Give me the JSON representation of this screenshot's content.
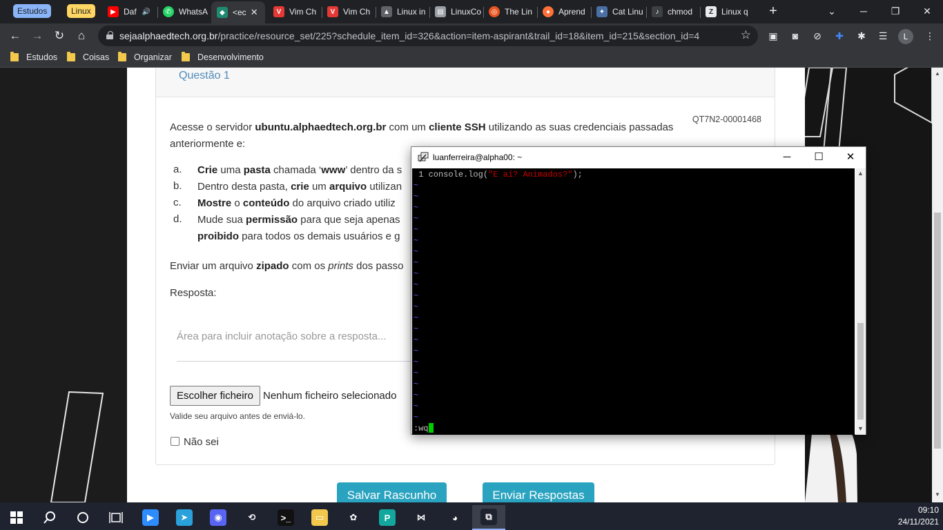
{
  "browser": {
    "tab_groups": [
      {
        "label": "Estudos",
        "bg": "#8ab4f8",
        "fg": "#202124"
      },
      {
        "label": "Linux",
        "bg": "#fdd663",
        "fg": "#202124"
      }
    ],
    "tabs": [
      {
        "title": "Daf",
        "icon": "youtube-icon",
        "color": "#ff0000",
        "glyph": "▶",
        "extra": "🔊"
      },
      {
        "title": "WhatsA",
        "icon": "whatsapp-icon",
        "color": "#25d366",
        "glyph": "✆"
      },
      {
        "title": "<ec",
        "icon": "alphaedtech-icon",
        "color": "#1f8a70",
        "glyph": "◆",
        "active": true
      },
      {
        "title": "Vim Ch",
        "icon": "vim-cheatsheet-icon",
        "color": "#e53935",
        "glyph": "V"
      },
      {
        "title": "Vim Ch",
        "icon": "vim-cheatsheet-icon",
        "color": "#e53935",
        "glyph": "V"
      },
      {
        "title": "Linux in",
        "icon": "linux-icon",
        "color": "#5f6368",
        "glyph": "▲"
      },
      {
        "title": "LinuxCo",
        "icon": "document-icon",
        "color": "#9aa0a6",
        "glyph": "▤"
      },
      {
        "title": "The Lin",
        "icon": "ubuntu-icon",
        "color": "#e95420",
        "glyph": "◎"
      },
      {
        "title": "Aprend",
        "icon": "firefox-icon",
        "color": "#ff7139",
        "glyph": "●"
      },
      {
        "title": "Cat Linu",
        "icon": "cat-icon",
        "color": "#4a6fa5",
        "glyph": "✦"
      },
      {
        "title": "chmod",
        "icon": "chmod-icon",
        "color": "#3c4043",
        "glyph": "♪"
      },
      {
        "title": "Linux q",
        "icon": "z-site-icon",
        "color": "#e8eaed",
        "glyph": "Z"
      }
    ],
    "url_host": "sejaalphaedtech.org.br",
    "url_path": "/practice/resource_set/225?schedule_item_id=326&action=item-aspirant&trail_id=18&item_id=215&section_id=4",
    "profile_initial": "L",
    "bookmarks": [
      "Estudos",
      "Coisas",
      "Organizar",
      "Desenvolvimento"
    ]
  },
  "question": {
    "title": "Questão 1",
    "code": "QT7N2-00001468",
    "intro": {
      "p1": "Acesse o servidor ",
      "b1": "ubuntu.alphaedtech.org.br",
      "p2": " com um ",
      "b2": "cliente SSH",
      "p3": " utilizando as suas credenciais passadas",
      "line2": "anteriormente e:"
    },
    "items": [
      {
        "letter": "a.",
        "parts": [
          {
            "b": "Crie"
          },
          {
            "t": " uma "
          },
          {
            "b": "pasta"
          },
          {
            "t": " chamada ‘"
          },
          {
            "b": "www"
          },
          {
            "t": "’ dentro da s"
          }
        ]
      },
      {
        "letter": "b.",
        "parts": [
          {
            "t": "Dentro desta pasta, "
          },
          {
            "b": "crie"
          },
          {
            "t": " um "
          },
          {
            "b": "arquivo"
          },
          {
            "t": " utilizan"
          }
        ]
      },
      {
        "letter": "c.",
        "parts": [
          {
            "b": "Mostre"
          },
          {
            "t": " o "
          },
          {
            "b": "conteúdo"
          },
          {
            "t": " do arquivo criado utiliz"
          }
        ]
      },
      {
        "letter": "d.",
        "parts": [
          {
            "t": "Mude sua "
          },
          {
            "b": "permissão"
          },
          {
            "t": " para que seja apenas "
          }
        ]
      },
      {
        "letter": "",
        "parts": [
          {
            "b": "proibido"
          },
          {
            "t": " para todos os demais usuários e g"
          }
        ]
      }
    ],
    "send": {
      "p1": "Enviar um arquivo ",
      "b1": "zipado",
      "p2": " com os ",
      "i1": "prints",
      "p3": " dos passo"
    },
    "answer_label": "Resposta:",
    "answer_placeholder": "Área para incluir anotação sobre a resposta...",
    "file_button": "Escolher ficheiro",
    "file_status": "Nenhum ficheiro selecionado",
    "validate_hint": "Valide seu arquivo antes de enviá-lo.",
    "dont_know": "Não sei",
    "save_draft": "Salvar Rascunho",
    "submit": "Enviar Respostas"
  },
  "putty": {
    "title": "luanferreira@alpha00: ~",
    "line1_num": "1",
    "line1_code": "console.log(",
    "line1_str": "\"E aí? Animados?\"",
    "line1_end": ");",
    "tilde_count": 22,
    "command": ":wq"
  },
  "taskbar": {
    "apps": [
      {
        "name": "zoom-icon",
        "color": "#2d8cff",
        "glyph": "▶"
      },
      {
        "name": "telegram-icon",
        "color": "#2aa1da",
        "glyph": "➤"
      },
      {
        "name": "discord-icon",
        "color": "#5865f2",
        "glyph": "◉"
      },
      {
        "name": "network-icon",
        "color": "#1f2330",
        "glyph": "⟲"
      },
      {
        "name": "terminal-icon",
        "color": "#111111",
        "glyph": ">_"
      },
      {
        "name": "file-explorer-icon",
        "color": "#f2c94c",
        "glyph": "▭"
      },
      {
        "name": "figma-icon",
        "color": "#1f2330",
        "glyph": "✿"
      },
      {
        "name": "postman-icon",
        "color": "#13a89e",
        "glyph": "P"
      },
      {
        "name": "vscode-icon",
        "color": "#1f2330",
        "glyph": "⋈"
      },
      {
        "name": "chrome-icon",
        "color": "#1f2330",
        "glyph": "◕"
      },
      {
        "name": "putty-icon",
        "color": "#1f2330",
        "glyph": "⧉",
        "active": true
      }
    ],
    "time": "09:10",
    "date": "24/11/2021"
  },
  "colors": {
    "accent_teal": "#29a3bf",
    "question_title": "#4f8ab8",
    "terminal_string": "#cc0000",
    "terminal_tilde": "#5555ff",
    "terminal_cursor": "#00cc00"
  }
}
